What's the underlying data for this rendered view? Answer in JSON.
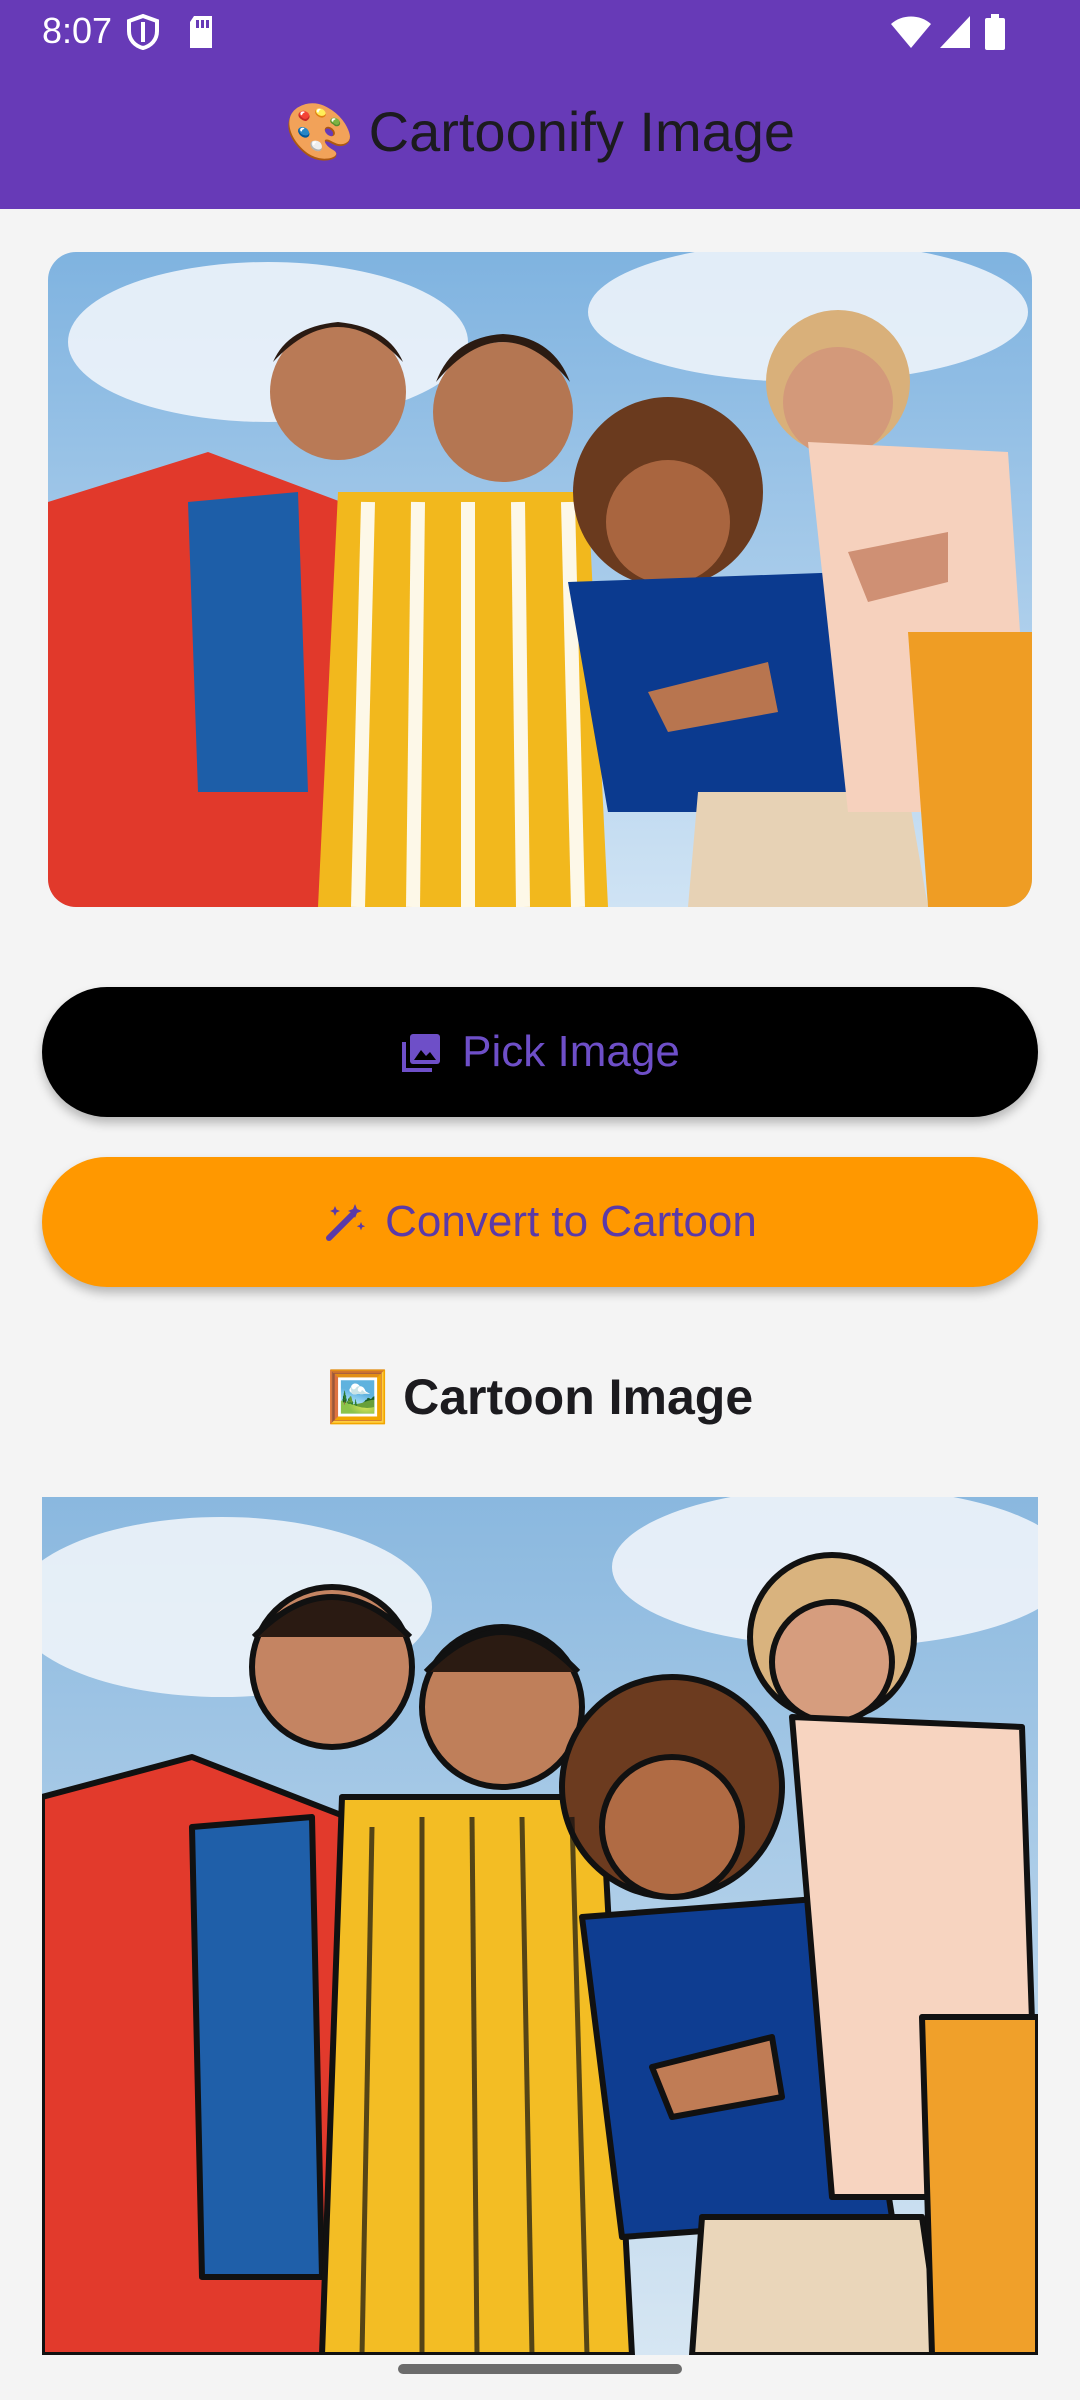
{
  "status_bar": {
    "time": "8:07",
    "left_icons": [
      "shield-icon",
      "sd-card-icon"
    ],
    "right_icons": [
      "wifi-icon",
      "signal-icon",
      "battery-icon"
    ]
  },
  "app_bar": {
    "title_emoji": "🎨",
    "title": "Cartoonify Image",
    "color": "#673ab7"
  },
  "original_image": {
    "description": "group photo, four smiling people against blue sky"
  },
  "buttons": {
    "pick_label": "Pick Image",
    "pick_icon": "image-icon",
    "convert_label": "Convert to Cartoon",
    "convert_icon": "magic-wand-icon",
    "convert_color": "#ff9800"
  },
  "result": {
    "title_emoji": "🖼️",
    "title": "Cartoon Image"
  }
}
